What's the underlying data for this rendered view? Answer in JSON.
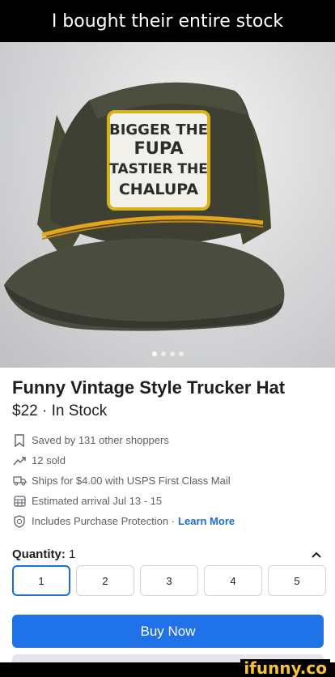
{
  "meme": {
    "caption": "I bought their entire stock",
    "watermark": "ifunny.co"
  },
  "photo": {
    "patch_lines": [
      "BIGGER THE",
      "FUPA",
      "TASTIER THE",
      "CHALUPA"
    ],
    "carousel_count": 4,
    "carousel_active": 0
  },
  "listing": {
    "title": "Funny Vintage Style Trucker Hat",
    "price_stock": "$22 · In Stock",
    "info": [
      {
        "icon": "bookmark-icon",
        "text": "Saved by 131 other shoppers"
      },
      {
        "icon": "trending-icon",
        "text": "12 sold"
      },
      {
        "icon": "truck-icon",
        "text": "Ships for $4.00 with USPS First Class Mail"
      },
      {
        "icon": "calendar-icon",
        "text": "Estimated arrival Jul 13 - 15"
      },
      {
        "icon": "shield-icon",
        "text": "Includes Purchase Protection · ",
        "link": "Learn More"
      }
    ],
    "quantity": {
      "label": "Quantity:",
      "value": "1",
      "options": [
        "1",
        "2",
        "3",
        "4",
        "5"
      ],
      "selected": "1"
    },
    "buy_label": "Buy Now"
  },
  "colors": {
    "accent": "#1f72e8",
    "link": "#1a6ed8",
    "brand_watermark": "#f5c43a"
  }
}
